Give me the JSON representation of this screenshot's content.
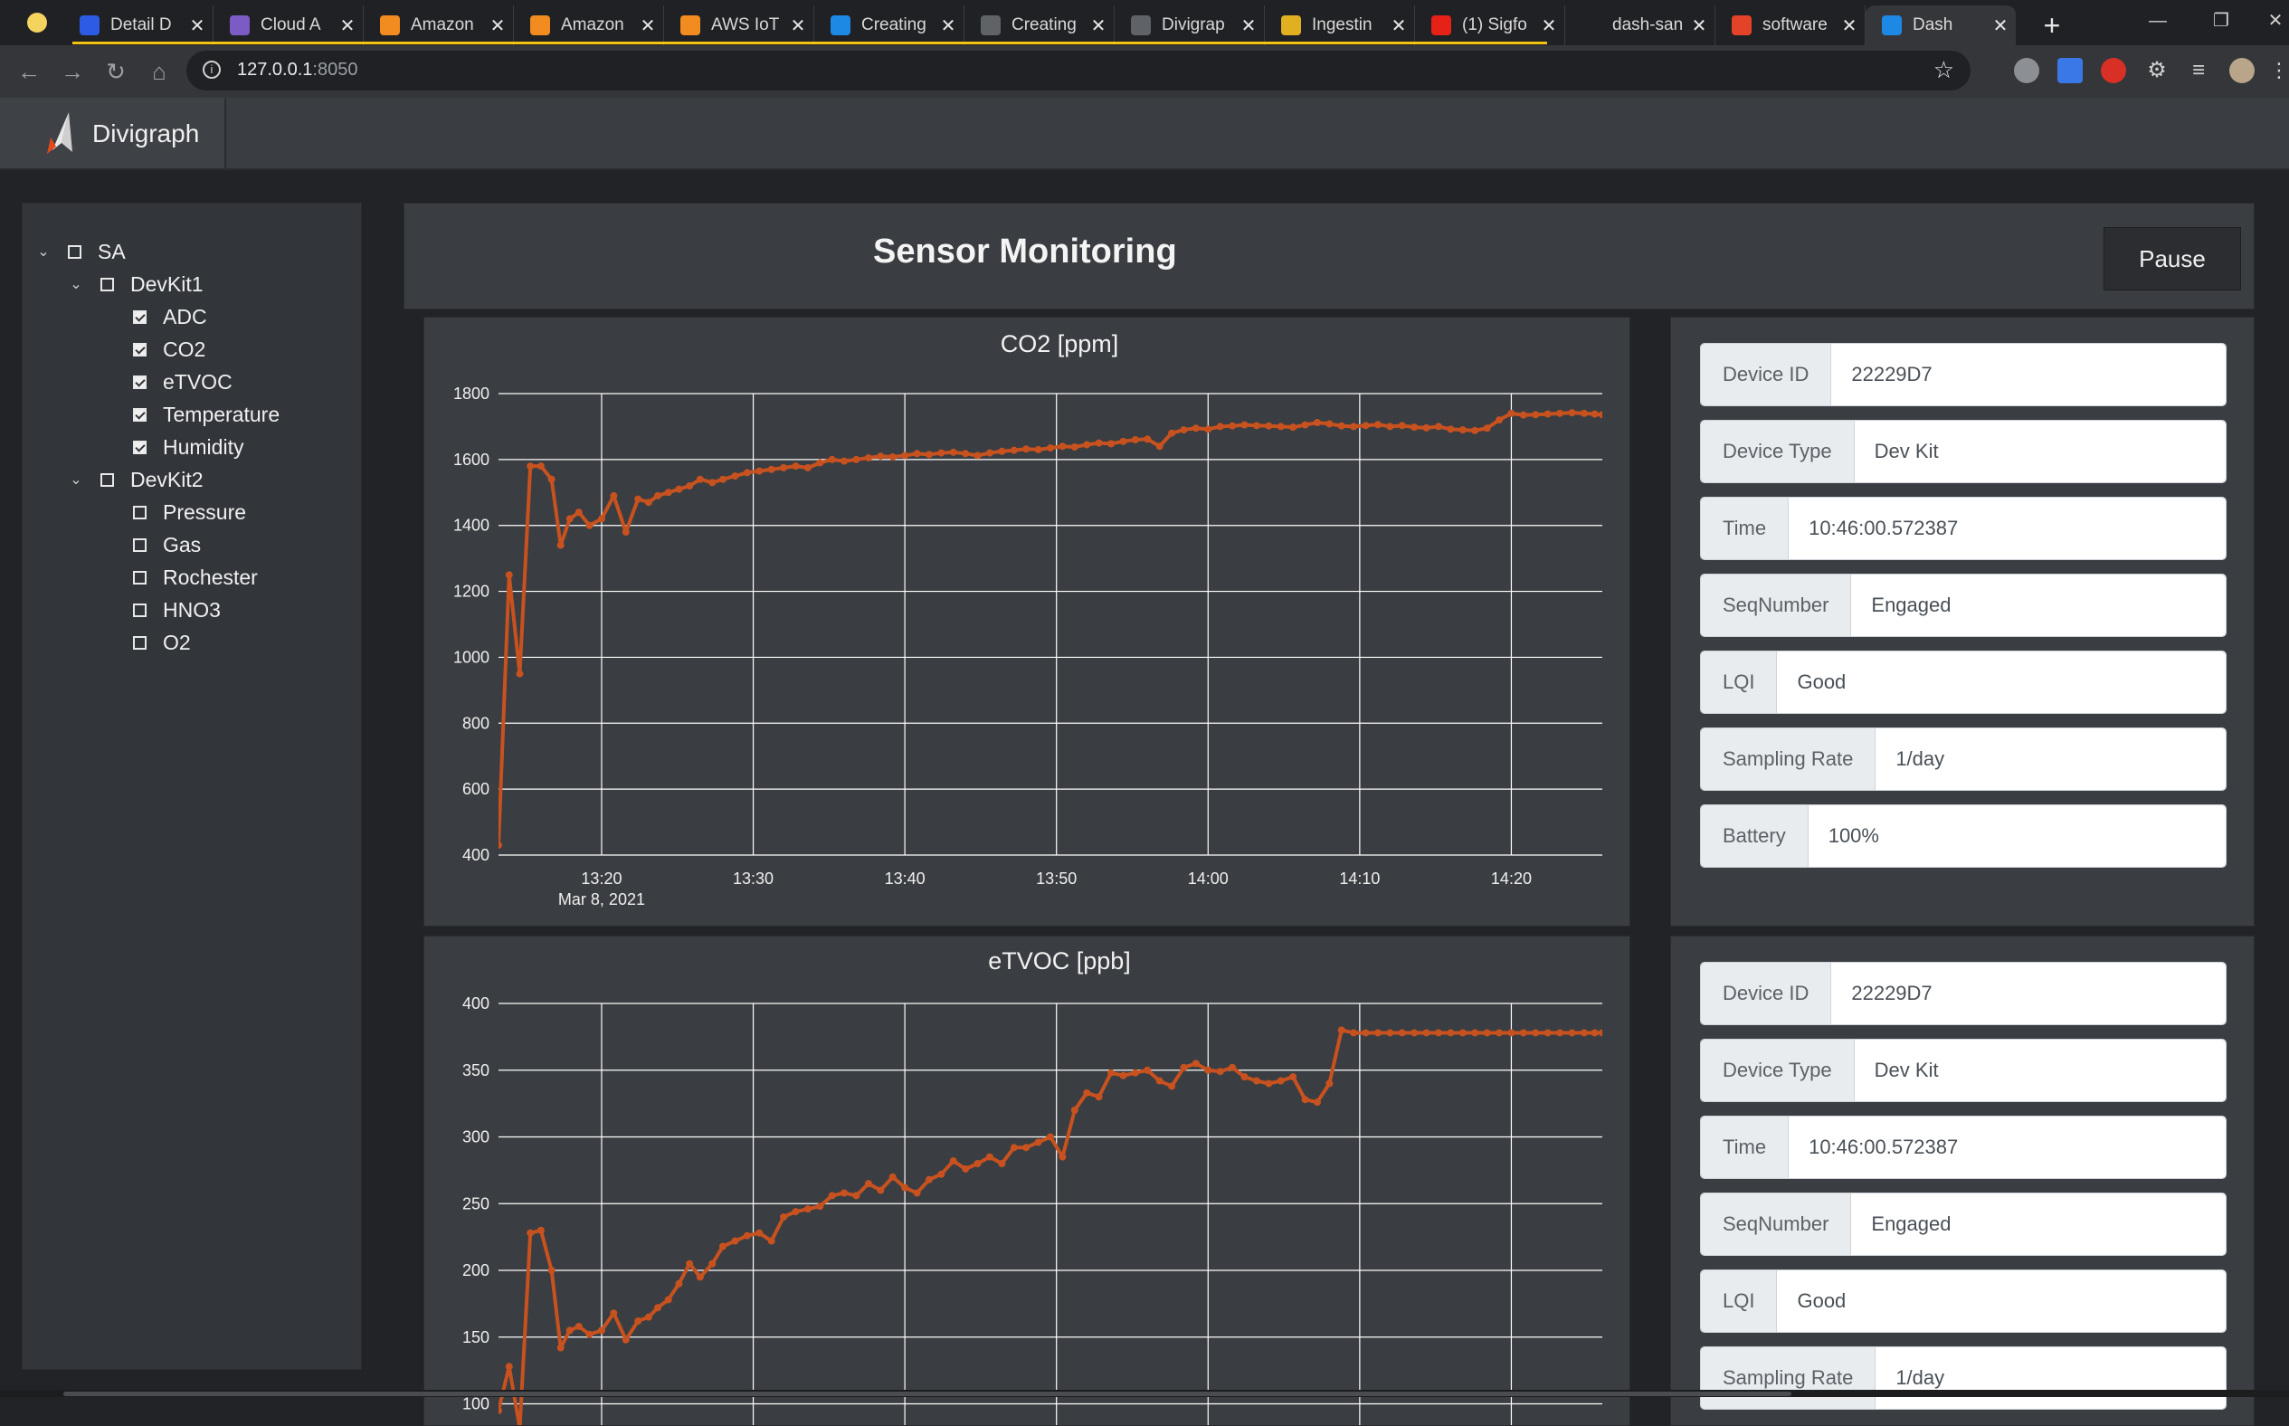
{
  "browser": {
    "tabs": [
      {
        "title": "Detail D",
        "icon": "double-circle-icon",
        "color": "#2d5be3"
      },
      {
        "title": "Cloud A",
        "icon": "h-logo-icon",
        "color": "#7c5cc4"
      },
      {
        "title": "Amazon",
        "icon": "aws-hex-icon",
        "color": "#f28b20"
      },
      {
        "title": "Amazon",
        "icon": "aws-hex-icon",
        "color": "#f28b20"
      },
      {
        "title": "AWS IoT",
        "icon": "aws-hex-icon",
        "color": "#f28b20"
      },
      {
        "title": "Creating",
        "icon": "hash-icon",
        "color": "#1e88e5"
      },
      {
        "title": "Creating",
        "icon": "infinity-icon",
        "color": "#5f6368"
      },
      {
        "title": "Divigrap",
        "icon": "globe-icon",
        "color": "#5f6368"
      },
      {
        "title": "Ingestin",
        "icon": "stacked-cube-icon",
        "color": "#e0b020"
      },
      {
        "title": "(1) Sigfo",
        "icon": "youtube-icon",
        "color": "#e62117"
      },
      {
        "title": "dash-san",
        "icon": "github-icon",
        "color": "#202124"
      },
      {
        "title": "software",
        "icon": "gitlab-icon",
        "color": "#e24329"
      },
      {
        "title": "Dash",
        "icon": "chart-icon",
        "color": "#1e88e5",
        "active": true
      }
    ],
    "url_host": "127.0.0.1",
    "url_port": ":8050"
  },
  "app": {
    "brand": "Divigraph",
    "title": "Sensor Monitoring",
    "pause_label": "Pause"
  },
  "tree": [
    {
      "label": "SA",
      "level": 0,
      "caret": true,
      "checked": false
    },
    {
      "label": "DevKit1",
      "level": 1,
      "caret": true,
      "checked": false
    },
    {
      "label": "ADC",
      "level": 2,
      "caret": false,
      "checked": true
    },
    {
      "label": "CO2",
      "level": 2,
      "caret": false,
      "checked": true
    },
    {
      "label": "eTVOC",
      "level": 2,
      "caret": false,
      "checked": true
    },
    {
      "label": "Temperature",
      "level": 2,
      "caret": false,
      "checked": true
    },
    {
      "label": "Humidity",
      "level": 2,
      "caret": false,
      "checked": true
    },
    {
      "label": "DevKit2",
      "level": 1,
      "caret": true,
      "checked": false
    },
    {
      "label": "Pressure",
      "level": 2,
      "caret": false,
      "checked": false
    },
    {
      "label": "Gas",
      "level": 2,
      "caret": false,
      "checked": false
    },
    {
      "label": "Rochester",
      "level": 2,
      "caret": false,
      "checked": false
    },
    {
      "label": "HNO3",
      "level": 2,
      "caret": false,
      "checked": false
    },
    {
      "label": "O2",
      "level": 2,
      "caret": false,
      "checked": false
    }
  ],
  "info_panels": [
    [
      {
        "label": "Device ID",
        "value": "22229D7"
      },
      {
        "label": "Device Type",
        "value": "Dev Kit"
      },
      {
        "label": "Time",
        "value": "10:46:00.572387"
      },
      {
        "label": "SeqNumber",
        "value": "Engaged"
      },
      {
        "label": "LQI",
        "value": "Good"
      },
      {
        "label": "Sampling Rate",
        "value": "1/day"
      },
      {
        "label": "Battery",
        "value": "100%"
      }
    ],
    [
      {
        "label": "Device ID",
        "value": "22229D7"
      },
      {
        "label": "Device Type",
        "value": "Dev Kit"
      },
      {
        "label": "Time",
        "value": "10:46:00.572387"
      },
      {
        "label": "SeqNumber",
        "value": "Engaged"
      },
      {
        "label": "LQI",
        "value": "Good"
      },
      {
        "label": "Sampling Rate",
        "value": "1/day"
      }
    ]
  ],
  "colors": {
    "line": "#c8521f",
    "grid": "#ffffff",
    "panel": "#3a3d41"
  },
  "chart_data": [
    {
      "type": "line",
      "title": "CO2 [ppm]",
      "x_ticks": [
        "13:20",
        "13:30",
        "13:40",
        "13:50",
        "14:00",
        "14:10",
        "14:20"
      ],
      "x_tick_minutes": [
        800,
        810,
        820,
        830,
        840,
        850,
        860
      ],
      "x_date_label": "Mar 8, 2021",
      "xlim_minutes": [
        793.2,
        866
      ],
      "ylim": [
        400,
        1800
      ],
      "y_ticks": [
        400,
        600,
        800,
        1000,
        1200,
        1400,
        1600,
        1800
      ],
      "series": [
        {
          "x_minutes": [
            793.2,
            793.9,
            794.6,
            795.3,
            796.0,
            796.7,
            797.3,
            797.9,
            798.5,
            799.2,
            800.0,
            800.8,
            801.6,
            802.4,
            803.1,
            803.7,
            804.4,
            805.1,
            805.8,
            806.5,
            807.3,
            808.0,
            808.8,
            809.6,
            810.4,
            811.2,
            812.0,
            812.8,
            813.6,
            814.4,
            815.2,
            816.0,
            816.8,
            817.6,
            818.4,
            819.2,
            820.0,
            820.8,
            821.6,
            822.4,
            823.2,
            824.0,
            824.8,
            825.6,
            826.4,
            827.2,
            828.0,
            828.8,
            829.6,
            830.4,
            831.2,
            832.0,
            832.8,
            833.6,
            834.4,
            835.2,
            836.0,
            836.8,
            837.6,
            838.4,
            839.2,
            840.0,
            840.8,
            841.6,
            842.4,
            843.2,
            844.0,
            844.8,
            845.6,
            846.4,
            847.2,
            848.0,
            848.8,
            849.6,
            850.4,
            851.2,
            852.0,
            852.8,
            853.6,
            854.4,
            855.2,
            856.0,
            856.8,
            857.6,
            858.4,
            859.2,
            860.0,
            860.8,
            861.6,
            862.4,
            863.2,
            864.0,
            864.8,
            865.5,
            866.0
          ],
          "values": [
            430,
            1250,
            950,
            1580,
            1580,
            1540,
            1340,
            1420,
            1440,
            1400,
            1420,
            1490,
            1380,
            1480,
            1470,
            1490,
            1500,
            1510,
            1520,
            1540,
            1530,
            1540,
            1550,
            1560,
            1565,
            1570,
            1575,
            1580,
            1575,
            1590,
            1600,
            1595,
            1600,
            1605,
            1610,
            1608,
            1612,
            1618,
            1615,
            1620,
            1622,
            1618,
            1612,
            1620,
            1625,
            1628,
            1632,
            1630,
            1635,
            1640,
            1638,
            1645,
            1650,
            1648,
            1655,
            1660,
            1662,
            1640,
            1680,
            1690,
            1695,
            1692,
            1700,
            1702,
            1705,
            1703,
            1702,
            1700,
            1698,
            1705,
            1712,
            1708,
            1702,
            1700,
            1703,
            1706,
            1700,
            1703,
            1698,
            1696,
            1700,
            1692,
            1690,
            1688,
            1695,
            1720,
            1740,
            1735,
            1736,
            1738,
            1740,
            1742,
            1740,
            1738,
            1736
          ]
        }
      ]
    },
    {
      "type": "line",
      "title": "eTVOC [ppb]",
      "x_ticks": [],
      "xlim_minutes": [
        793.2,
        866
      ],
      "ylim": [
        80,
        400
      ],
      "y_ticks": [
        100,
        150,
        200,
        250,
        300,
        350,
        400
      ],
      "series": [
        {
          "x_minutes": [
            793.2,
            793.9,
            794.6,
            795.3,
            796.0,
            796.7,
            797.3,
            797.9,
            798.5,
            799.2,
            800.0,
            800.8,
            801.6,
            802.4,
            803.1,
            803.7,
            804.4,
            805.1,
            805.8,
            806.5,
            807.3,
            808.0,
            808.8,
            809.6,
            810.4,
            811.2,
            812.0,
            812.8,
            813.6,
            814.4,
            815.2,
            816.0,
            816.8,
            817.6,
            818.4,
            819.2,
            820.0,
            820.8,
            821.6,
            822.4,
            823.2,
            824.0,
            824.8,
            825.6,
            826.4,
            827.2,
            828.0,
            828.8,
            829.6,
            830.4,
            831.2,
            832.0,
            832.8,
            833.6,
            834.4,
            835.2,
            836.0,
            836.8,
            837.6,
            838.4,
            839.2,
            840.0,
            840.8,
            841.6,
            842.4,
            843.2,
            844.0,
            844.8,
            845.6,
            846.4,
            847.2,
            848.0,
            848.8,
            849.6,
            850.4,
            851.2,
            852.0,
            852.8,
            853.6,
            854.4,
            855.2,
            856.0,
            856.8,
            857.6,
            858.4,
            859.2,
            860.0,
            860.8,
            861.6,
            862.4,
            863.2,
            864.0,
            864.8,
            865.5,
            866.0
          ],
          "values": [
            95,
            128,
            82,
            228,
            230,
            200,
            142,
            155,
            158,
            152,
            155,
            168,
            148,
            162,
            165,
            172,
            178,
            190,
            205,
            195,
            205,
            218,
            222,
            226,
            228,
            222,
            240,
            244,
            246,
            248,
            256,
            258,
            256,
            265,
            260,
            270,
            262,
            258,
            268,
            272,
            282,
            276,
            280,
            285,
            280,
            292,
            292,
            296,
            300,
            285,
            320,
            333,
            330,
            348,
            346,
            348,
            350,
            342,
            338,
            352,
            355,
            350,
            349,
            352,
            345,
            342,
            340,
            342,
            345,
            328,
            326,
            340,
            380,
            378,
            378,
            378,
            378,
            378,
            378,
            378,
            378,
            378,
            378,
            378,
            378,
            378,
            378,
            378,
            378,
            378,
            378,
            378,
            378,
            378,
            378
          ]
        }
      ]
    }
  ]
}
